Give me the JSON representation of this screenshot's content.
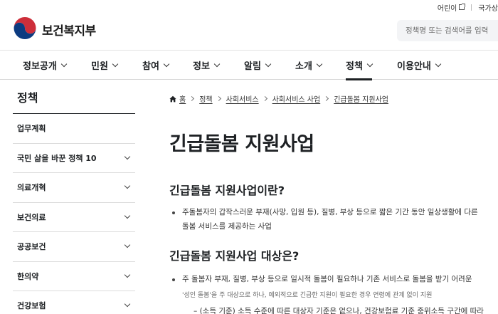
{
  "utility": {
    "accessibility_link": "어린이",
    "lang_link": "국가상"
  },
  "header": {
    "logo_text": "보건복지부",
    "search_placeholder": "정책명 또는 검색어를 입력"
  },
  "gnb": [
    {
      "label": "정보공개"
    },
    {
      "label": "민원"
    },
    {
      "label": "참여"
    },
    {
      "label": "정보"
    },
    {
      "label": "알림"
    },
    {
      "label": "소개"
    },
    {
      "label": "정책",
      "active": true
    },
    {
      "label": "이용안내"
    }
  ],
  "sidebar": {
    "title": "정책",
    "items": [
      {
        "label": "업무계획",
        "expandable": false
      },
      {
        "label": "국민 삶을 바꾼 정책 10",
        "expandable": true
      },
      {
        "label": "의료개혁",
        "expandable": true
      },
      {
        "label": "보건의료",
        "expandable": true
      },
      {
        "label": "공공보건",
        "expandable": true
      },
      {
        "label": "한의약",
        "expandable": true
      },
      {
        "label": "건강보험",
        "expandable": true
      }
    ]
  },
  "breadcrumb": [
    "홈",
    "정책",
    "사회서비스",
    "사회서비스 사업",
    "긴급돌봄 지원사업"
  ],
  "content": {
    "title": "긴급돌봄 지원사업",
    "section1": {
      "heading": "긴급돌봄 지원사업이란?",
      "line1": "주돌봄자의 갑작스러운 부재(사망, 입원 등), 질병, 부상 등으로 짧은 기간 동안 일상생활에 다른",
      "line2": "돌봄 서비스를 제공하는 사업"
    },
    "section2": {
      "heading": "긴급돌봄 지원사업 대상은?",
      "line1": "주 돌봄자 부재, 질병, 부상 등으로 일시적 돌봄이 필요하나 기존 서비스로 돌봄을 받기 어려운",
      "note": "'성인 돌봄'을 주 대상으로 하나, 예외적으로 긴급한 지원이 필요한 경우 연령에 관계 없이 지원",
      "sub1": "– (소득 기준) 소득 수준에 따른 대상자 기준은 없으나, 건강보험료 기준 중위소득 구간에 따라"
    }
  }
}
